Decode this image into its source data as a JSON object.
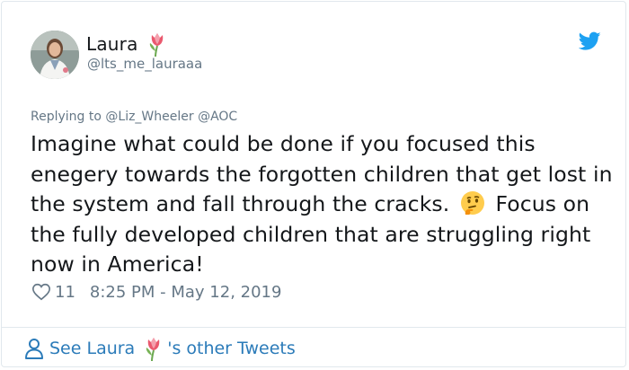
{
  "author": {
    "display_name": "Laura",
    "handle": "@lts_me_lauraaa",
    "name_emoji": "tulip-emoji"
  },
  "reply": {
    "prefix": "Replying to",
    "mentions": "@Liz_Wheeler @AOC"
  },
  "tweet": {
    "text_part1": "Imagine what could be done if you focused this enegery towards the forgotten children that get lost in the system and fall through the cracks.",
    "emoji": "thinking-face-emoji",
    "text_part2": "Focus on the fully developed children that are struggling right now in America!"
  },
  "meta": {
    "likes": "11",
    "timestamp": "8:25 PM - May 12, 2019"
  },
  "footer": {
    "link_prefix": "See Laura",
    "link_suffix": "'s other Tweets"
  },
  "colors": {
    "text": "#14171a",
    "secondary": "#657786",
    "link": "#2b7bb9",
    "twitter_blue": "#1da1f2",
    "border": "#e1e8ed"
  }
}
